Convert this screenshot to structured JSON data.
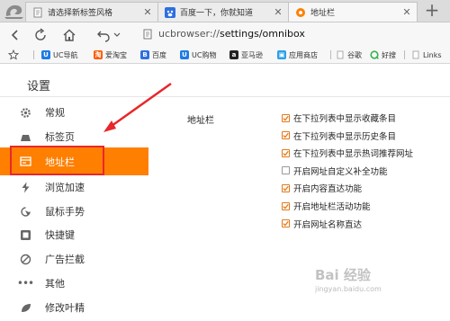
{
  "tabs": [
    {
      "title": "请选择新标签风格",
      "active": false
    },
    {
      "title": "百度一下，你就知道",
      "active": false
    },
    {
      "title": "地址栏",
      "active": true
    }
  ],
  "new_tab_label": "+",
  "toolbar": {
    "url_prefix": "ucbrowser://",
    "url_path": "settings/omnibox"
  },
  "bookmarks": [
    {
      "label": "UC导航",
      "icon": "uc-nav-icon",
      "color": "#1e7be6"
    },
    {
      "label": "爱淘宝",
      "icon": "taobao-icon",
      "color": "#ff5a00"
    },
    {
      "label": "百度",
      "icon": "baidu-icon",
      "color": "#2d6fe0"
    },
    {
      "label": "UC购物",
      "icon": "uc-shop-icon",
      "color": "#1e7be6"
    },
    {
      "label": "亚马逊",
      "icon": "amazon-icon",
      "color": "#222222"
    },
    {
      "label": "应用商店",
      "icon": "app-store-icon",
      "color": "#2aa0e8"
    },
    {
      "label": "谷歌",
      "icon": "file-icon",
      "color": "#bbbbbb"
    },
    {
      "label": "好搜",
      "icon": "haosou-icon",
      "color": "#37b24d"
    },
    {
      "label": "Links",
      "icon": "file-icon",
      "color": "#bbbbbb"
    }
  ],
  "page_title": "设置",
  "sidebar": [
    {
      "label": "常规",
      "icon": "gear-icon"
    },
    {
      "label": "标签页",
      "icon": "tab-icon"
    },
    {
      "label": "地址栏",
      "icon": "address-bar-icon",
      "active": true
    },
    {
      "label": "浏览加速",
      "icon": "lightning-icon"
    },
    {
      "label": "鼠标手势",
      "icon": "mouse-gesture-icon"
    },
    {
      "label": "快捷键",
      "icon": "keyboard-icon"
    },
    {
      "label": "广告拦截",
      "icon": "block-icon"
    },
    {
      "label": "其他",
      "icon": "more-icon"
    },
    {
      "label": "修改叶精",
      "icon": "leaf-icon"
    }
  ],
  "section": {
    "label": "地址栏",
    "options": [
      {
        "label": "在下拉列表中显示收藏条目",
        "checked": true
      },
      {
        "label": "在下拉列表中显示历史条目",
        "checked": true
      },
      {
        "label": "在下拉列表中显示热词推荐网址",
        "checked": true
      },
      {
        "label": "开启网址自定义补全功能",
        "checked": false
      },
      {
        "label": "开启内容直达功能",
        "checked": true
      },
      {
        "label": "开启地址栏活动功能",
        "checked": true
      },
      {
        "label": "开启网址名称直达",
        "checked": true
      }
    ]
  },
  "colors": {
    "accent": "#ff7f00",
    "highlight": "#e8272b",
    "check": "#e37a1a"
  },
  "watermark": {
    "text": "Bai 经验",
    "sub": "jingyan.baidu.com"
  }
}
